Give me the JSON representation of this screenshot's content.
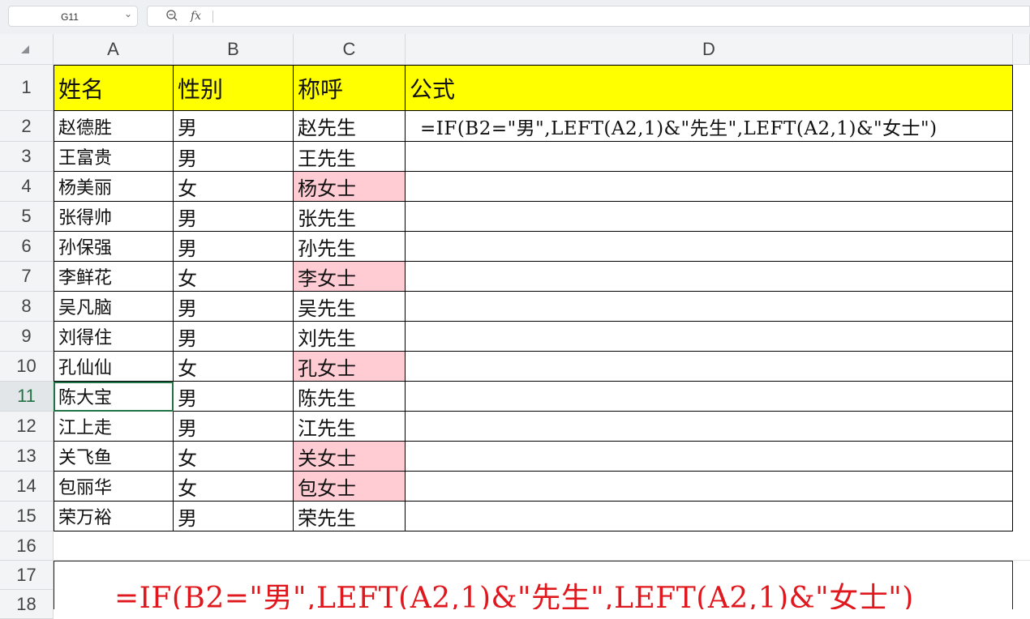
{
  "formula_bar": {
    "cell_ref": "G11",
    "fx_label": "fx",
    "formula_value": ""
  },
  "columns": [
    "A",
    "B",
    "C",
    "D"
  ],
  "row_numbers": [
    "1",
    "2",
    "3",
    "4",
    "5",
    "6",
    "7",
    "8",
    "9",
    "10",
    "11",
    "12",
    "13",
    "14",
    "15",
    "16",
    "17",
    "18"
  ],
  "active_row": "11",
  "header_row": {
    "a": "姓名",
    "b": "性别",
    "c": "称呼",
    "d": "公式"
  },
  "rows": [
    {
      "name": "赵德胜",
      "gender": "男",
      "title": "赵先生",
      "female": false
    },
    {
      "name": "王富贵",
      "gender": "男",
      "title": "王先生",
      "female": false
    },
    {
      "name": "杨美丽",
      "gender": "女",
      "title": "杨女士",
      "female": true
    },
    {
      "name": "张得帅",
      "gender": "男",
      "title": "张先生",
      "female": false
    },
    {
      "name": "孙保强",
      "gender": "男",
      "title": "孙先生",
      "female": false
    },
    {
      "name": "李鲜花",
      "gender": "女",
      "title": "李女士",
      "female": true
    },
    {
      "name": "吴凡脑",
      "gender": "男",
      "title": "吴先生",
      "female": false
    },
    {
      "name": "刘得住",
      "gender": "男",
      "title": "刘先生",
      "female": false
    },
    {
      "name": "孔仙仙",
      "gender": "女",
      "title": "孔女士",
      "female": true
    },
    {
      "name": "陈大宝",
      "gender": "男",
      "title": "陈先生",
      "female": false
    },
    {
      "name": "江上走",
      "gender": "男",
      "title": "江先生",
      "female": false
    },
    {
      "name": "关飞鱼",
      "gender": "女",
      "title": "关女士",
      "female": true
    },
    {
      "name": "包丽华",
      "gender": "女",
      "title": "包女士",
      "female": true
    },
    {
      "name": "荣万裕",
      "gender": "男",
      "title": "荣先生",
      "female": false
    }
  ],
  "d2_formula": "=IF(B2=\"男\",LEFT(A2,1)&\"先生\",LEFT(A2,1)&\"女士\")",
  "big_formula": "=IF(B2=\"男\",LEFT(A2,1)&\"先生\",LEFT(A2,1)&\"女士\")",
  "colors": {
    "header_fill": "#ffff00",
    "female_fill": "#ffccd4",
    "big_formula_text": "#e0181e",
    "active_row_text": "#217346"
  }
}
